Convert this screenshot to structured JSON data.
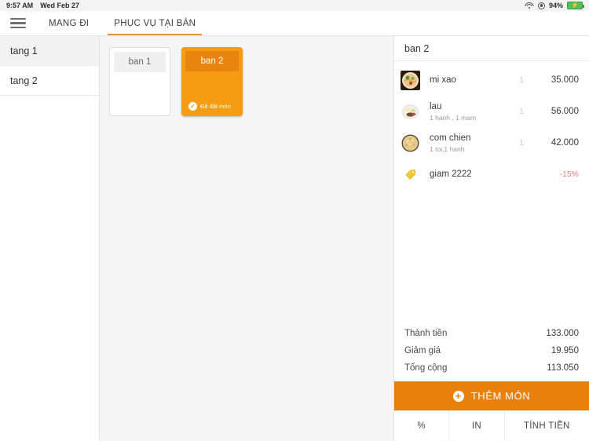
{
  "status_bar": {
    "time": "9:57 AM",
    "date": "Wed Feb 27",
    "battery_percent": "94%",
    "wifi_icon": "wifi-icon",
    "lock_icon": "rotation-lock-icon",
    "battery_icon": "battery-charging-icon"
  },
  "topbar": {
    "menu_icon": "hamburger-menu-icon",
    "tabs": [
      {
        "label": "MANG ĐI",
        "active": false
      },
      {
        "label": "PHỤC VỤ TẠI BÀN",
        "active": true
      }
    ]
  },
  "sidebar": {
    "floors": [
      {
        "label": "tang 1",
        "selected": true
      },
      {
        "label": "tang 2",
        "selected": false
      }
    ]
  },
  "tables": [
    {
      "name": "ban 1",
      "state": "free",
      "status_text": ""
    },
    {
      "name": "ban 2",
      "state": "busy",
      "status_text": "Đã đặt món",
      "status_icon": "check-circle-icon"
    }
  ],
  "order": {
    "title": "ban 2",
    "items": [
      {
        "name": "mi xao",
        "note": "",
        "qty": "1",
        "price": "35.000",
        "thumb": "noodles-photo"
      },
      {
        "name": "lau",
        "note": "1 hanh , 1 mam",
        "qty": "1",
        "price": "56.000",
        "thumb": "hotpot-photo"
      },
      {
        "name": "com chien",
        "note": "1 toi,1 hanh",
        "qty": "1",
        "price": "42.000",
        "thumb": "fried-rice-photo"
      }
    ],
    "discount": {
      "icon": "coupon-tag-icon",
      "name": "giam 2222",
      "value": "-15%"
    },
    "totals": [
      {
        "label": "Thành tiền",
        "value": "133.000"
      },
      {
        "label": "Giảm giá",
        "value": "19.950"
      },
      {
        "label": "Tổng cộng",
        "value": "113.050"
      }
    ],
    "add_button": {
      "label": "THÊM MÓN",
      "icon": "plus-circle-icon"
    },
    "actions": [
      {
        "label": "%"
      },
      {
        "label": "IN"
      },
      {
        "label": "TÍNH TIỀN"
      }
    ]
  },
  "colors": {
    "accent_orange": "#e8810c",
    "table_busy": "#f59c13",
    "table_busy_header": "#e8850e",
    "tab_underline": "#d79a3c",
    "discount_red": "#ef7d7d",
    "battery_green": "#5bbd5b"
  }
}
